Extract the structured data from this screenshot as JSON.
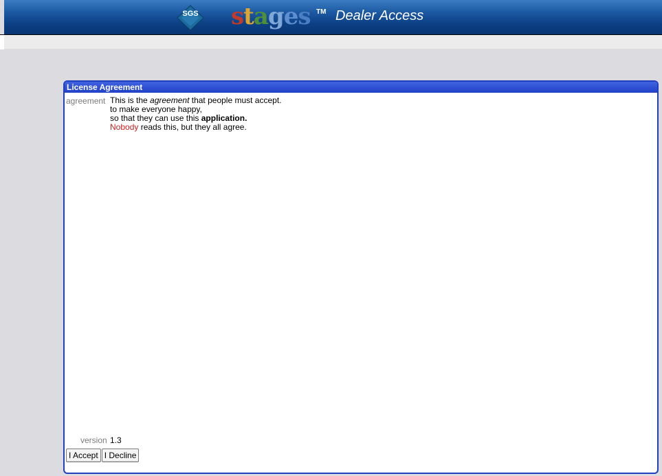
{
  "header": {
    "brand_badge": "SGS",
    "logo_letters": [
      "s",
      "t",
      "a",
      "g",
      "e",
      "s"
    ],
    "trademark": "TM",
    "title": "Dealer Access"
  },
  "dialog": {
    "title": "License Agreement",
    "agreement_label": "agreement",
    "agreement_lines": {
      "l1_a": "This is the ",
      "l1_em": "agreement",
      "l1_b": " that people must accept.",
      "l2": "to make everyone happy,",
      "l3_a": "so that they can use this ",
      "l3_bold": "application.",
      "l4_red": "Nobody",
      "l4_b": " reads this, but they all agree."
    },
    "version_label": "version",
    "version_value": "1.3",
    "accept_label": "I Accept",
    "decline_label": "I Decline"
  },
  "colors": {
    "header_blue": "#0c3f84",
    "dialog_border": "#1f3fbf",
    "highlight_red": "#cc2020"
  }
}
